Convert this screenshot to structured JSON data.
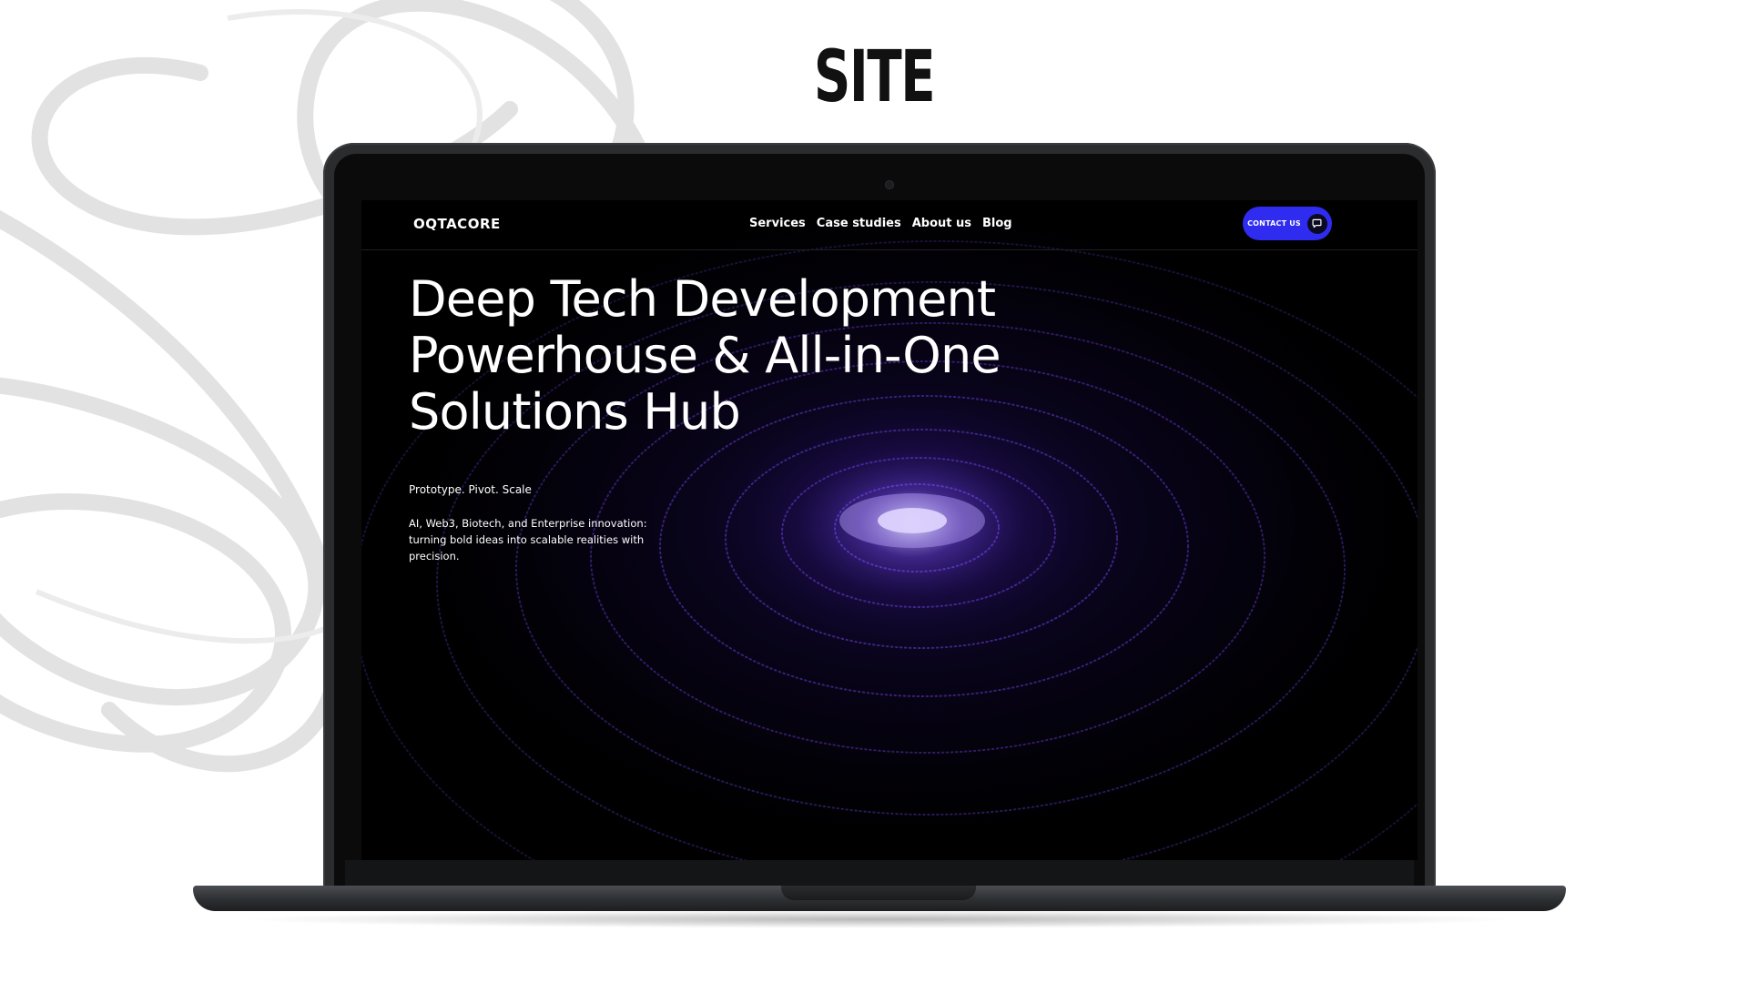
{
  "page": {
    "heading": "SITE"
  },
  "website": {
    "logo": "OQTACORE",
    "nav": {
      "services": "Services",
      "case_studies": "Case studies",
      "about_us": "About us",
      "blog": "Blog"
    },
    "contact_button": {
      "label": "CONTACT US",
      "icon": "chat-bubble-icon"
    },
    "hero": {
      "title_lines": [
        "Deep Tech Development",
        "Powerhouse & All-in-One",
        "Solutions Hub"
      ],
      "tagline": "Prototype. Pivot. Scale",
      "description": "AI, Web3, Biotech, and Enterprise innovation: turning bold ideas into scalable realities with precision."
    }
  },
  "colors": {
    "accent": "#2f2cf0",
    "site_background": "#000000",
    "galaxy_glow": "#8a5cff",
    "laptop_body": "#2a2c2e"
  }
}
